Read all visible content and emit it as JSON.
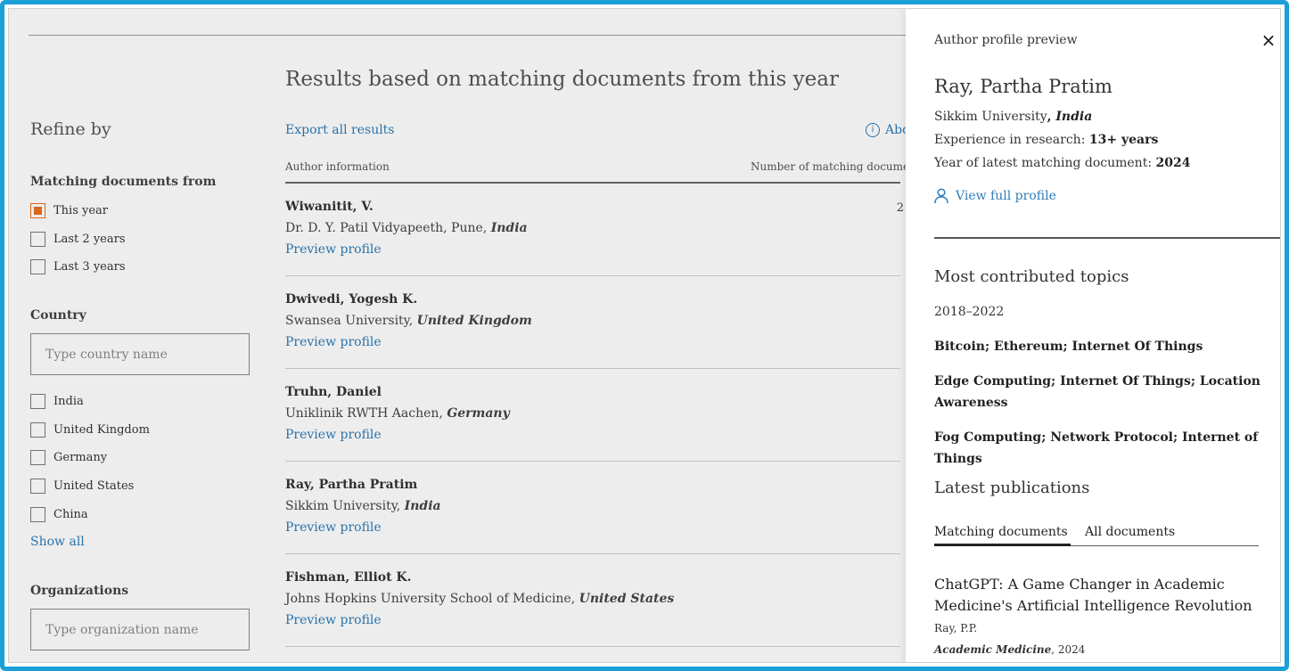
{
  "sidebar": {
    "refine_title": "Refine by",
    "matching_title": "Matching documents from",
    "period_options": [
      {
        "label": "This year",
        "checked": true
      },
      {
        "label": "Last 2 years",
        "checked": false
      },
      {
        "label": "Last 3 years",
        "checked": false
      }
    ],
    "country_title": "Country",
    "country_placeholder": "Type country name",
    "countries": [
      "India",
      "United Kingdom",
      "Germany",
      "United States",
      "China"
    ],
    "show_all": "Show all",
    "organizations_title": "Organizations",
    "organization_placeholder": "Type organization name"
  },
  "results": {
    "title": "Results based on matching documents from this year",
    "export_label": "Export all results",
    "about_label": "Abo",
    "col_author": "Author information",
    "col_count": "Number of matching documen",
    "preview_label": "Preview profile",
    "rows": [
      {
        "name": "Wiwanitit, V.",
        "affiliation": "Dr. D. Y. Patil Vidyapeeth, Pune,",
        "country": "India",
        "count": "2"
      },
      {
        "name": "Dwivedi, Yogesh K.",
        "affiliation": "Swansea University,",
        "country": "United Kingdom",
        "count": ""
      },
      {
        "name": "Truhn, Daniel",
        "affiliation": "Uniklinik RWTH Aachen,",
        "country": "Germany",
        "count": ""
      },
      {
        "name": "Ray, Partha Pratim",
        "affiliation": "Sikkim University,",
        "country": "India",
        "count": ""
      },
      {
        "name": "Fishman, Elliot K.",
        "affiliation": "Johns Hopkins University School of Medicine,",
        "country": "United States",
        "count": ""
      }
    ]
  },
  "panel": {
    "label": "Author profile preview",
    "close_symbol": "×",
    "name": "Ray, Partha Pratim",
    "affiliation": "Sikkim University",
    "country_sep": ", ",
    "country": "India",
    "experience_label": "Experience in research: ",
    "experience_value": "13+ years",
    "latest_label": "Year of latest matching document: ",
    "latest_value": "2024",
    "view_profile": "View full profile",
    "topics_title": "Most contributed topics",
    "topics_years": "2018–2022",
    "topics": [
      "Bitcoin; Ethereum; Internet Of Things",
      "Edge Computing; Internet Of Things; Location Awareness",
      "Fog Computing; Network Protocol; Internet of Things"
    ],
    "publications_title": "Latest publications",
    "tab_matching": "Matching documents",
    "tab_all": "All documents",
    "publication": {
      "title": "ChatGPT: A Game Changer in Academic Medicine's Artificial Intelligence Revolution",
      "authors": "Ray, P.P.",
      "journal": "Academic Medicine",
      "year_text": ", 2024"
    }
  },
  "colors": {
    "frame": "#1a9fd8",
    "link": "#2e7cb7",
    "checkbox_checked": "#e9711c"
  }
}
